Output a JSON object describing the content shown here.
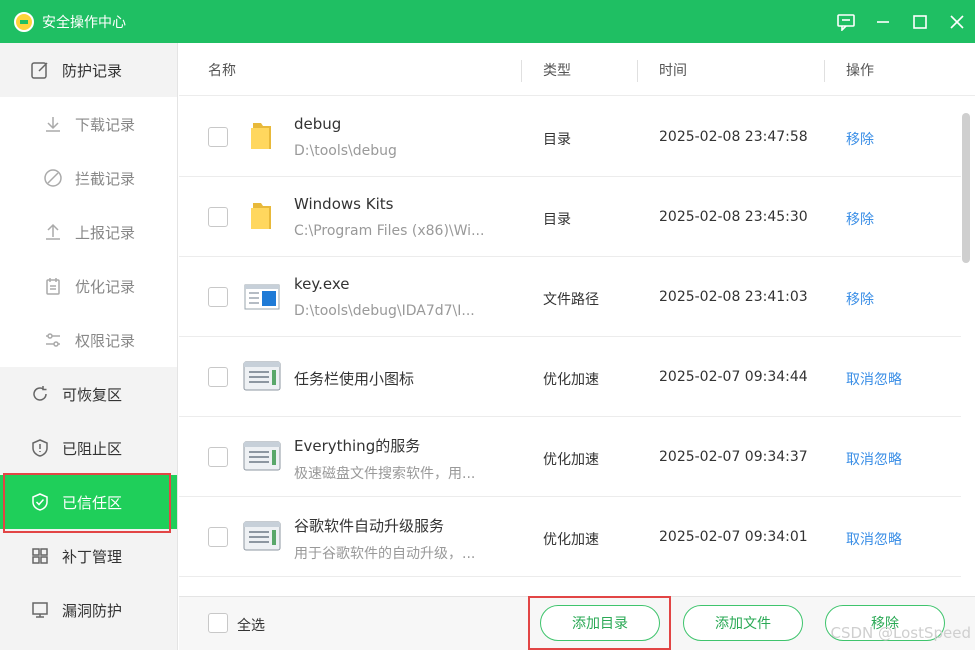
{
  "window": {
    "title": "安全操作中心"
  },
  "sidebar": {
    "items": [
      {
        "label": "防护记录",
        "icon": "edit-icon"
      },
      {
        "label": "下载记录",
        "icon": "download-icon"
      },
      {
        "label": "拦截记录",
        "icon": "block-icon"
      },
      {
        "label": "上报记录",
        "icon": "upload-icon"
      },
      {
        "label": "优化记录",
        "icon": "calendar-icon"
      },
      {
        "label": "权限记录",
        "icon": "sliders-icon"
      },
      {
        "label": "可恢复区",
        "icon": "refresh-icon"
      },
      {
        "label": "已阻止区",
        "icon": "shield-alert-icon"
      },
      {
        "label": "已信任区",
        "icon": "shield-check-icon"
      },
      {
        "label": "补丁管理",
        "icon": "grid-icon"
      },
      {
        "label": "漏洞防护",
        "icon": "monitor-icon"
      }
    ]
  },
  "table": {
    "headers": {
      "name": "名称",
      "type": "类型",
      "time": "时间",
      "action": "操作"
    },
    "rows": [
      {
        "name": "debug",
        "path": "D:\\tools\\debug",
        "type": "目录",
        "time": "2025-02-08 23:47:58",
        "action": "移除",
        "icon": "folder-icon"
      },
      {
        "name": "Windows Kits",
        "path": "C:\\Program Files (x86)\\Wi...",
        "type": "目录",
        "time": "2025-02-08 23:45:30",
        "action": "移除",
        "icon": "folder-icon"
      },
      {
        "name": "key.exe",
        "path": "D:\\tools\\debug\\IDA7d7\\I...",
        "type": "文件路径",
        "time": "2025-02-08 23:41:03",
        "action": "移除",
        "icon": "exe-icon"
      },
      {
        "name": "任务栏使用小图标",
        "path": "",
        "type": "优化加速",
        "time": "2025-02-07 09:34:44",
        "action": "取消忽略",
        "icon": "app-window-icon"
      },
      {
        "name": "Everything的服务",
        "path": "极速磁盘文件搜索软件，用...",
        "type": "优化加速",
        "time": "2025-02-07 09:34:37",
        "action": "取消忽略",
        "icon": "app-window-icon"
      },
      {
        "name": "谷歌软件自动升级服务",
        "path": "用于谷歌软件的自动升级，...",
        "type": "优化加速",
        "time": "2025-02-07 09:34:01",
        "action": "取消忽略",
        "icon": "app-window-icon"
      }
    ]
  },
  "footer": {
    "select_all": "全选",
    "add_dir": "添加目录",
    "add_file": "添加文件",
    "remove": "移除"
  },
  "watermark": "CSDN @LostSpeed",
  "colors": {
    "brand": "#1fbf63",
    "active": "#1fcf5a",
    "link": "#3a8ee6",
    "highlight": "#e24545"
  }
}
